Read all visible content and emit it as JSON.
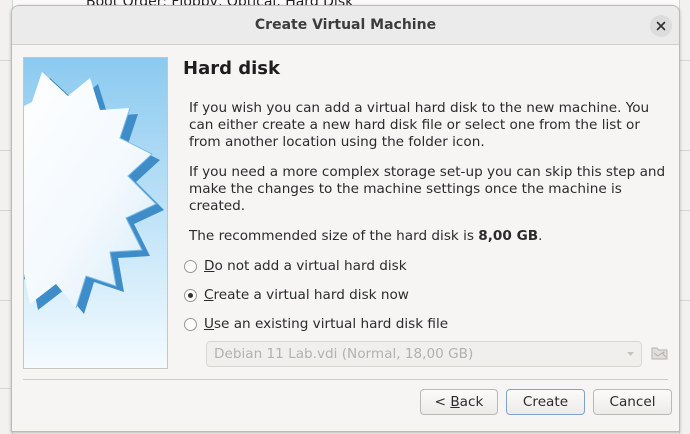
{
  "background": {
    "partial_text": "Boot Order:       Floppy, Optical, Hard Disk"
  },
  "dialog": {
    "title": "Create Virtual Machine",
    "close_icon": "close-icon",
    "heading": "Hard disk",
    "paragraphs": [
      "If you wish you can add a virtual hard disk to the new machine. You can either create a new hard disk file or select one from the list or from another location using the folder icon.",
      "If you need a more complex storage set-up you can skip this step and make the changes to the machine settings once the machine is created."
    ],
    "recommended_prefix": "The recommended size of the hard disk is ",
    "recommended_size": "8,00 GB",
    "recommended_suffix": ".",
    "options": [
      {
        "mnemonic": "D",
        "rest": "o not add a virtual hard disk",
        "checked": false
      },
      {
        "mnemonic": "C",
        "rest": "reate a virtual hard disk now",
        "checked": true
      },
      {
        "mnemonic": "U",
        "rest": "se an existing virtual hard disk file",
        "checked": false
      }
    ],
    "disk_select_value": "Debian 11 Lab.vdi (Normal, 18,00 GB)",
    "folder_icon": "folder-icon",
    "buttons": {
      "back_prefix": "< ",
      "back_mnemonic": "B",
      "back_rest": "ack",
      "create": "Create",
      "cancel": "Cancel"
    }
  },
  "colors": {
    "accent_border": "#7fa3d0",
    "banner_blue": "#8ecbf0"
  }
}
